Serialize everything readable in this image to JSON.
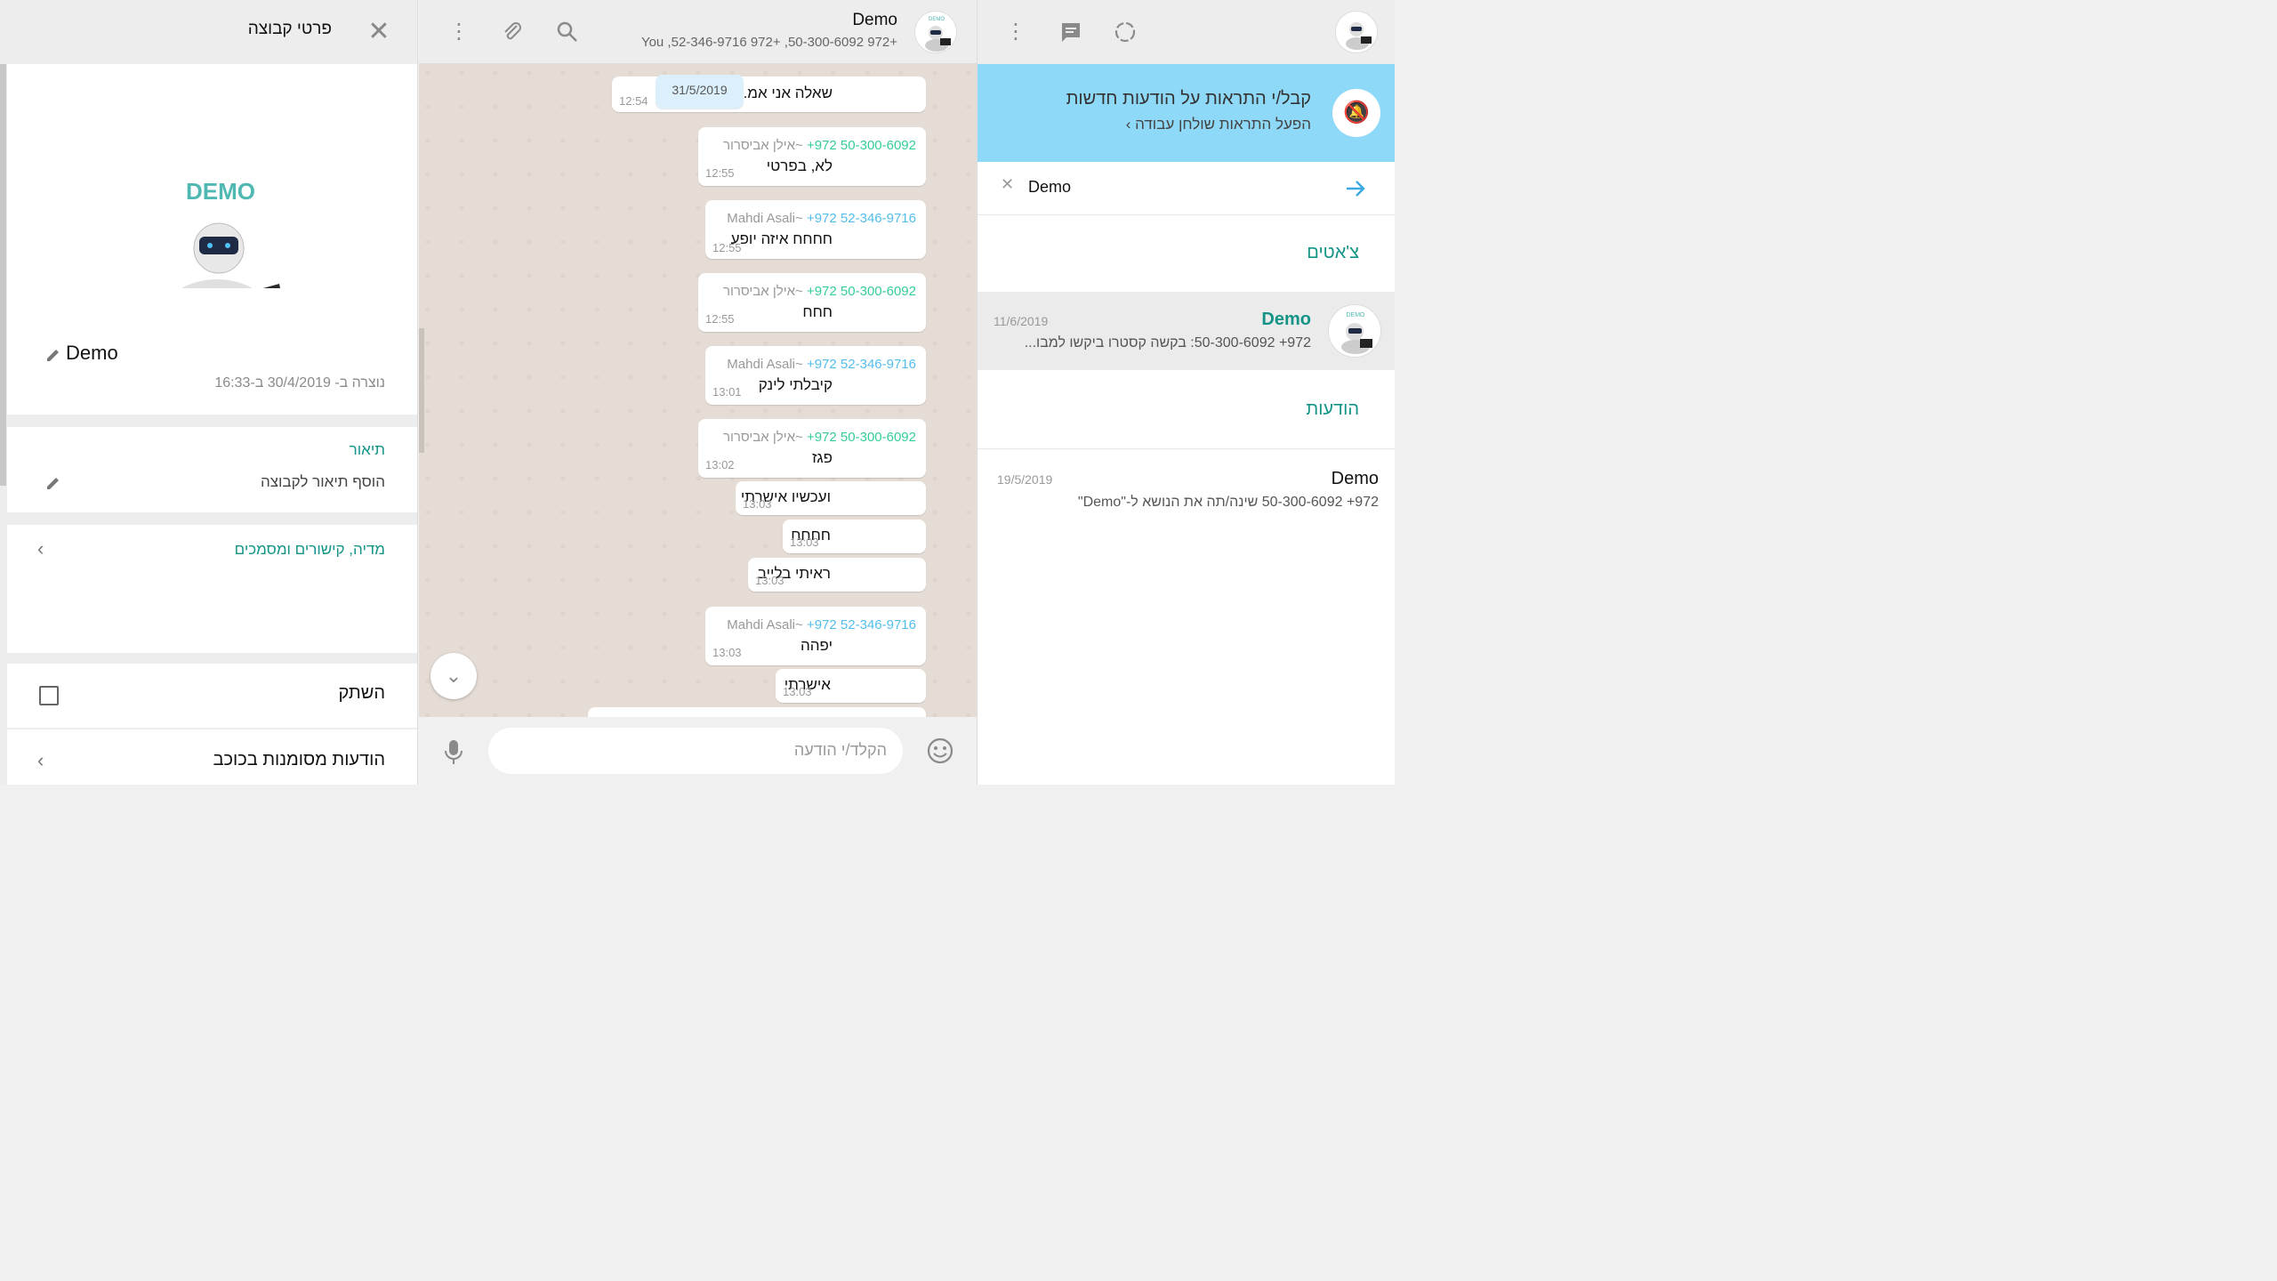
{
  "group_info": {
    "header_title": "פרטי קבוצה",
    "avatar_text": "DEMO",
    "name": "Demo",
    "created": "נוצרה ב- 30/4/2019 ב-16:33",
    "description_label": "תיאור",
    "description_placeholder": "הוסף תיאור לקבוצה",
    "media_label": "מדיה, קישורים ומסמכים",
    "mute_label": "השתק",
    "starred_label": "הודעות מסומנות בכוכב"
  },
  "chat": {
    "title": "Demo",
    "participants": "You ,52-346-9716 972+ ,50-300-6092 972+",
    "avatar_text": "DEMO",
    "date_pill": "31/5/2019",
    "input_placeholder": "הקלד/י הודעה",
    "messages": [
      {
        "phone": "",
        "name": "",
        "text": "שאלה אני אמ... כאן?",
        "time": "12:54"
      },
      {
        "phone": "50-300-6092 972+",
        "name": "~אילן אביסרור",
        "text": "לא, בפרטי",
        "time": "12:55"
      },
      {
        "phone": "52-346-9716 972+",
        "name": "~Mahdi Asali",
        "text": "חחחח איזה יופע",
        "time": "12:55"
      },
      {
        "phone": "50-300-6092 972+",
        "name": "~אילן אביסרור",
        "text": "חחח",
        "time": "12:55"
      },
      {
        "phone": "52-346-9716 972+",
        "name": "~Mahdi Asali",
        "text": "קיבלתי לינק",
        "time": "13:01"
      },
      {
        "phone": "50-300-6092 972+",
        "name": "~אילן אביסרור",
        "text": "פגז",
        "time": "13:02"
      },
      {
        "phone": "",
        "name": "",
        "text": "ועכשיו אישרתי",
        "time": "13:03"
      },
      {
        "phone": "",
        "name": "",
        "text": "חחחח",
        "time": "13:03"
      },
      {
        "phone": "",
        "name": "",
        "text": "ראיתי בלייב",
        "time": "13:03"
      },
      {
        "phone": "52-346-9716 972+",
        "name": "~Mahdi Asali",
        "text": "יפהה",
        "time": "13:03"
      },
      {
        "phone": "",
        "name": "",
        "text": "אישרתי",
        "time": "13:03"
      }
    ]
  },
  "list": {
    "notif_title": "קבל/י התראות על הודעות חדשות",
    "notif_link": "הפעל התראות שולחן עבודה ›",
    "search_value": "Demo",
    "chats_header": "צ'אטים",
    "chat_row": {
      "name": "Demo",
      "date": "11/6/2019",
      "preview": "972+ 50-300-6092: בקשה קסטרו ביקשו למבו...",
      "avatar_text": "DEMO"
    },
    "messages_header": "הודעות",
    "msg_row": {
      "name": "Demo",
      "date": "19/5/2019",
      "preview": "972+ 50-300-6092 שינה/תה את הנושא ל-\"Demo\""
    }
  },
  "colors": {
    "accent": "#139487",
    "notif": "#8fd9f8",
    "chat_bg": "#e5ddd5"
  }
}
